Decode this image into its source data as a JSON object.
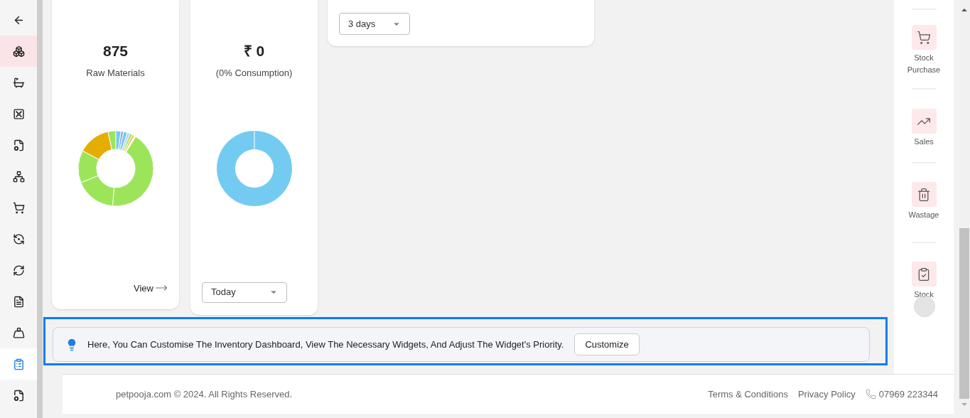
{
  "sidebar": {
    "items": [
      {
        "selected": false,
        "hovered": false
      },
      {
        "selected": false,
        "hovered": true
      },
      {
        "selected": false,
        "hovered": false
      },
      {
        "selected": false,
        "hovered": false
      },
      {
        "selected": false,
        "hovered": false
      },
      {
        "selected": false,
        "hovered": false
      },
      {
        "selected": false,
        "hovered": false
      },
      {
        "selected": false,
        "hovered": false
      },
      {
        "selected": false,
        "hovered": false
      },
      {
        "selected": false,
        "hovered": false
      },
      {
        "selected": false,
        "hovered": false
      },
      {
        "selected": true,
        "hovered": false
      },
      {
        "selected": false,
        "hovered": false
      }
    ]
  },
  "cards": [
    {
      "kind": "stat",
      "value": "875",
      "label": "Raw Materials",
      "link": "View"
    },
    {
      "kind": "consumption",
      "value": "₹ 0",
      "label": "(0% Consumption)",
      "dropdown": "Today"
    },
    {
      "kind": "filter",
      "dropdown": "3 days"
    }
  ],
  "banner": {
    "text": "Here, You Can Customise The Inventory Dashboard, View The Necessary Widgets, And Adjust The Widget's Priority.",
    "button": "Customize"
  },
  "quick_actions": [
    {
      "label": "Stock Purchase"
    },
    {
      "label": "Sales"
    },
    {
      "label": "Wastage"
    },
    {
      "label": "Stock"
    }
  ],
  "footer": {
    "copyright": "petpooja.com © 2024. All Rights Reserved.",
    "links": [
      "Terms & Conditions",
      "Privacy Policy"
    ],
    "phone": "07969 223344"
  }
}
